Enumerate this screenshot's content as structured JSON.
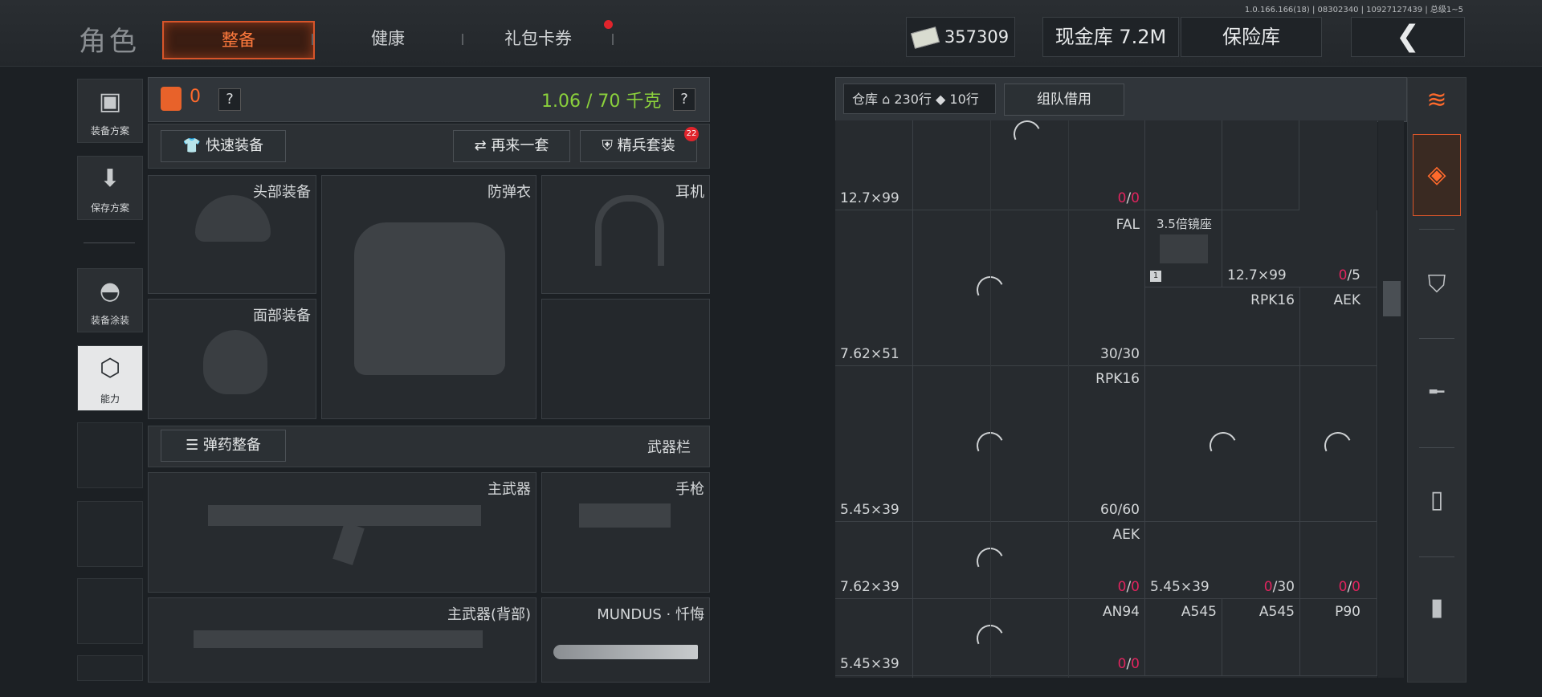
{
  "header": {
    "version": "1.0.166.166(18) | 08302340 | 10927127439 | 总级1~5",
    "logo": "角色",
    "tabs": [
      {
        "label": "整备",
        "active": true
      },
      {
        "label": "健康",
        "active": false
      },
      {
        "label": "礼包卡券",
        "active": false
      }
    ],
    "money": "357309",
    "cash_vault": "现金库 7.2M",
    "safe": "保险库"
  },
  "left_nav": {
    "items": [
      {
        "label": "装备方案",
        "icon": "vest-icon"
      },
      {
        "label": "保存方案",
        "icon": "download-icon"
      },
      {
        "label": "装备涂装",
        "icon": "helmet-paint-icon"
      },
      {
        "label": "能力",
        "icon": "ability-icon"
      }
    ]
  },
  "loadout": {
    "armor_count": "0",
    "help": "?",
    "weight": "1.06 / 70 千克",
    "quick_equip": "快速装备",
    "again": "再来一套",
    "elite_set": "精兵套装",
    "elite_badge": "22",
    "slots": {
      "head": "头部装备",
      "vest": "防弹衣",
      "headset": "耳机",
      "face": "面部装备"
    },
    "ammo_equip": "弹药整备",
    "weapon_bar": "武器栏",
    "weapons": {
      "primary": "主武器",
      "pistol": "手枪",
      "primary_back": "主武器(背部)",
      "knife": "MUNDUS · 忏悔"
    }
  },
  "storage": {
    "label": "仓库",
    "rows_home": "230行",
    "rows_ticket": "10行",
    "team_borrow": "组队借用",
    "cells": [
      {
        "caliber": "12.7×99",
        "count_a": "0",
        "count_b": "0"
      },
      {
        "name": "FAL",
        "caliber": "7.62×51",
        "count": "30/30"
      },
      {
        "name": "3.5倍镜座",
        "badge": "1"
      },
      {
        "caliber": "12.7×99",
        "count_a": "0",
        "count_b": "5"
      },
      {
        "name": "RPK16"
      },
      {
        "name": "AEK"
      },
      {
        "name": "RPK16",
        "caliber": "5.45×39",
        "count": "60/60"
      },
      {
        "name": "AEK",
        "caliber": "7.62×39",
        "count_a": "0",
        "count_b": "0"
      },
      {
        "caliber": "5.45×39",
        "count_a": "0",
        "count_b": "30"
      },
      {
        "count_a": "0",
        "count_b": "0"
      },
      {
        "name": "AN94",
        "caliber": "5.45×39",
        "count_a": "0",
        "count_b": "0"
      },
      {
        "name": "A545"
      },
      {
        "name": "A545"
      },
      {
        "name": "P90"
      }
    ]
  },
  "colors": {
    "accent": "#ff7a3d",
    "weight_green": "#8bd13c",
    "count_red": "#e0245e",
    "badge_red": "#e0242c"
  }
}
